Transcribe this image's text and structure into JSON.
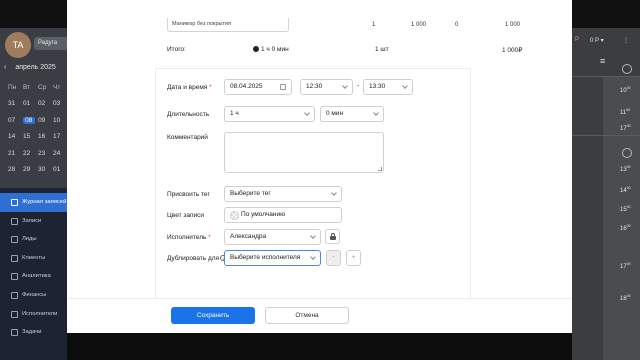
{
  "background": {
    "avatar_initials": "TA",
    "profile_button": "Радуга",
    "calendar": {
      "month": "апрель 2025",
      "prev_arrow": "‹",
      "weekdays": [
        "Пн",
        "Вт",
        "Ср",
        "Чт"
      ],
      "rows": [
        [
          "31",
          "01",
          "02",
          "03"
        ],
        [
          "07",
          "08",
          "09",
          "10"
        ],
        [
          "14",
          "15",
          "16",
          "17"
        ],
        [
          "21",
          "22",
          "23",
          "24"
        ],
        [
          "28",
          "29",
          "30",
          "01"
        ]
      ],
      "selected": "08"
    },
    "nav": [
      {
        "label": "Журнал записей",
        "active": true
      },
      {
        "label": "Записи",
        "active": false
      },
      {
        "label": "Лиды",
        "active": false
      },
      {
        "label": "Клиенты",
        "active": false
      },
      {
        "label": "Аналитика",
        "active": false
      },
      {
        "label": "Финансы",
        "active": false
      },
      {
        "label": "Исполнители",
        "active": false
      },
      {
        "label": "Задачи",
        "active": false
      }
    ],
    "right": {
      "header_a": "Р",
      "header_b": "0 Р ▾",
      "times": [
        "10",
        "11",
        "17",
        "13",
        "14",
        "15",
        "16",
        "17",
        "18"
      ],
      "minutes": "00"
    }
  },
  "modal": {
    "top_row": {
      "service": "Маникюр без покрытия",
      "qty": "1",
      "price": "1 000",
      "discount": "0",
      "total": "1 000"
    },
    "totals": {
      "label": "Итого:",
      "duration": "1 ч 0 мин",
      "qty": "1 шт",
      "sum": "1 000₽"
    },
    "form": {
      "date_label": "Дата и время",
      "date_value": "08.04.2025",
      "time_from": "12:30",
      "time_dash": "-",
      "time_to": "13:30",
      "duration_label": "Длительность",
      "duration_hours": "1 ч",
      "duration_minutes": "0 мин",
      "comment_label": "Комментарий",
      "comment_value": "",
      "tag_label": "Присвоить тег",
      "tag_placeholder": "Выберите тег",
      "color_label": "Цвет записи",
      "color_value": "По умолчанию",
      "executor_label": "Исполнитель",
      "executor_value": "Александра",
      "duplicate_label": "Дублировать для",
      "duplicate_placeholder": "Выберите исполнителя",
      "minus": "-",
      "plus": "+"
    },
    "footer": {
      "save": "Сохранить",
      "cancel": "Отмена"
    }
  },
  "colors": {
    "primary": "#1a73e8",
    "required": "#e53935",
    "sidebar": "#1c2434",
    "nav_active": "#2f6fd1"
  }
}
